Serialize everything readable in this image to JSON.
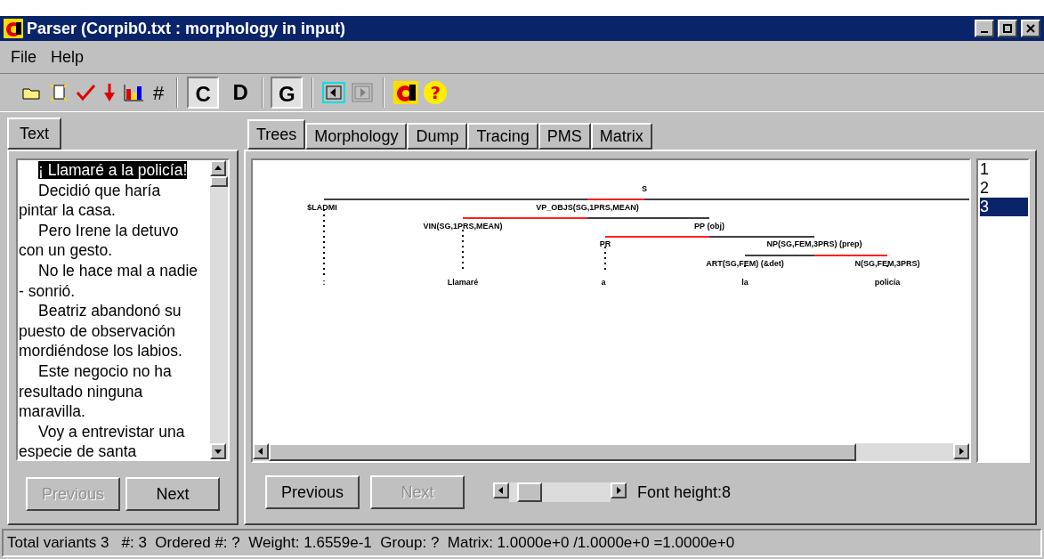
{
  "window": {
    "title": "Parser (Corpib0.txt : morphology in input)"
  },
  "menu": [
    "File",
    "Help"
  ],
  "toolbar": {
    "toggles": [
      {
        "label": "C",
        "selected": true
      },
      {
        "label": "D",
        "selected": false
      },
      {
        "label": "G",
        "selected": true
      }
    ],
    "hash": "#",
    "help": "?"
  },
  "left_panel": {
    "tab": "Text",
    "lines": [
      {
        "text": "¡ Llamaré a la policía!",
        "selected": true
      },
      {
        "text": "Decidió que haría pintar la casa.",
        "selected": false
      },
      {
        "text": "Pero Irene la detuvo con un gesto.",
        "selected": false
      },
      {
        "text": "No le hace mal a nadie - sonrió.",
        "selected": false
      },
      {
        "text": "Beatriz abandonó su puesto de observación mordiéndose los labios.",
        "selected": false
      },
      {
        "text": "Este negocio no ha resultado ninguna maravilla.",
        "selected": false
      },
      {
        "text": "Voy a entrevistar una especie de santa",
        "selected": false
      }
    ],
    "buttons": [
      {
        "label": "Previous",
        "disabled": true
      },
      {
        "label": "Next",
        "disabled": false
      }
    ]
  },
  "tabs": [
    {
      "label": "Trees",
      "selected": true
    },
    {
      "label": "Morphology",
      "selected": false
    },
    {
      "label": "Dump",
      "selected": false
    },
    {
      "label": "Tracing",
      "selected": false
    },
    {
      "label": "PMS",
      "selected": false
    },
    {
      "label": "Matrix",
      "selected": false
    }
  ],
  "tree": {
    "nodes": [
      {
        "label": "S"
      },
      {
        "label": "$LADMI"
      },
      {
        "label": "VP_OBJS(SG,1PRS,MEAN)"
      },
      {
        "label": "VIN(SG,1PRS,MEAN)"
      },
      {
        "label": "PP (obj)"
      },
      {
        "label": "PR"
      },
      {
        "label": "NP(SG,FEM,3PRS) (prep)"
      },
      {
        "label": "ART(SG,FEM) (&det)"
      },
      {
        "label": "N(SG,FEM,3PRS)"
      }
    ],
    "leaves": [
      ":",
      "Llamaré",
      "a",
      "la",
      "policía"
    ]
  },
  "variants": [
    {
      "label": "1",
      "selected": false
    },
    {
      "label": "2",
      "selected": false
    },
    {
      "label": "3",
      "selected": true
    }
  ],
  "bottom": {
    "buttons": [
      {
        "label": "Previous",
        "disabled": false
      },
      {
        "label": "Next",
        "disabled": true
      }
    ],
    "font_height": "Font height:8",
    "font_slider": {
      "level": 0.1
    }
  },
  "status_bar": "Total variants 3   #: 3  Ordered #: ?  Weight: 1.6559e-1  Group: ?  Matrix: 1.0000e+0 /1.0000e+0 =1.0000e+0"
}
